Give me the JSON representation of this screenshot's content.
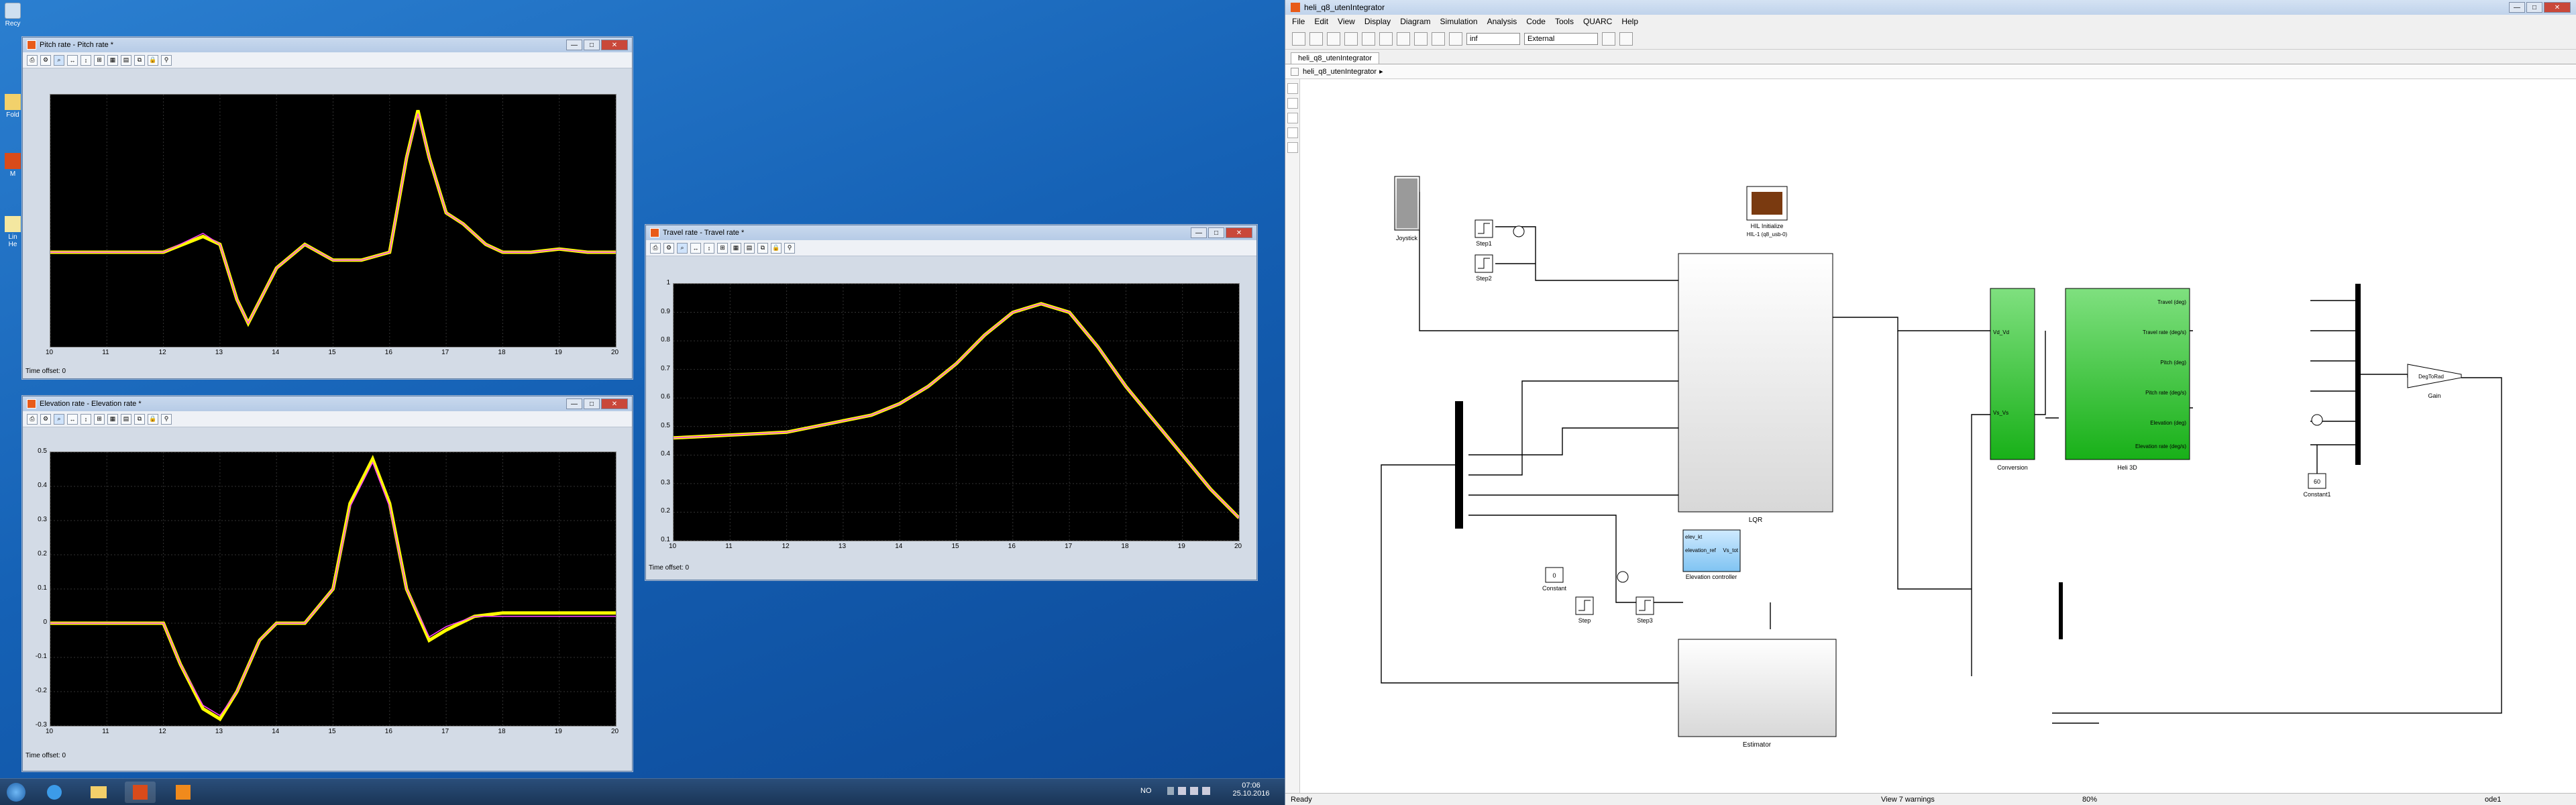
{
  "desktop": {
    "icons": [
      {
        "label": "Recy",
        "icon": "recycle-bin-icon"
      },
      {
        "label": "Fold",
        "icon": "folder-icon"
      },
      {
        "label": "M",
        "icon": "matlab-icon"
      },
      {
        "label": "Lin He",
        "icon": "document-icon"
      }
    ]
  },
  "scopes": [
    {
      "id": "pitch",
      "title": "Pitch rate - Pitch rate *",
      "time_offset_label": "Time offset:",
      "time_offset_value": "0",
      "chart_data": {
        "type": "line",
        "xlim": [
          10,
          20
        ],
        "ylim": [
          -0.6,
          1.0
        ],
        "x_ticks": [
          "10",
          "11",
          "12",
          "13",
          "14",
          "15",
          "16",
          "17",
          "18",
          "19",
          "20"
        ],
        "y_ticks": [],
        "background": "#000000",
        "series": [
          {
            "color": "#ffff00",
            "x": [
              10,
              11,
              12,
              12.7,
              13,
              13.3,
              13.5,
              14,
              14.5,
              15,
              15.5,
              16,
              16.3,
              16.5,
              16.7,
              17,
              17.3,
              17.7,
              18,
              18.5,
              19,
              19.5,
              20
            ],
            "y": [
              0,
              0,
              0,
              0.1,
              0.05,
              -0.3,
              -0.45,
              -0.1,
              0.05,
              -0.05,
              -0.05,
              0,
              0.6,
              0.9,
              0.6,
              0.25,
              0.18,
              0.05,
              0,
              0,
              0.02,
              0,
              0
            ]
          },
          {
            "color": "#ff40ff",
            "x": [
              10,
              11,
              12,
              12.7,
              13,
              13.3,
              13.5,
              14,
              14.5,
              15,
              15.5,
              16,
              16.3,
              16.5,
              16.7,
              17,
              17.3,
              17.7,
              18,
              18.5,
              19,
              19.5,
              20
            ],
            "y": [
              0,
              0,
              0,
              0.12,
              0.05,
              -0.3,
              -0.45,
              -0.1,
              0.05,
              -0.05,
              -0.05,
              0,
              0.6,
              0.88,
              0.6,
              0.25,
              0.18,
              0.05,
              0,
              0,
              0.02,
              0,
              0
            ]
          }
        ]
      }
    },
    {
      "id": "elevation",
      "title": "Elevation rate - Elevation rate *",
      "time_offset_label": "Time offset:",
      "time_offset_value": "0",
      "chart_data": {
        "type": "line",
        "xlim": [
          10,
          20
        ],
        "ylim": [
          -0.3,
          0.5
        ],
        "x_ticks": [
          "10",
          "11",
          "12",
          "13",
          "14",
          "15",
          "16",
          "17",
          "18",
          "19",
          "20"
        ],
        "y_ticks": [
          "0.5",
          "0.4",
          "0.3",
          "0.2",
          "0.1",
          "0",
          "-0.1",
          "-0.2",
          "-0.3"
        ],
        "background": "#000000",
        "series": [
          {
            "color": "#ffff00",
            "x": [
              10,
              11,
              12,
              12.3,
              12.7,
              13,
              13.3,
              13.7,
              14,
              14.5,
              15,
              15.3,
              15.7,
              16,
              16.3,
              16.7,
              17,
              17.5,
              18,
              18.5,
              19,
              19.5,
              20
            ],
            "y": [
              0,
              0,
              0,
              -0.12,
              -0.25,
              -0.28,
              -0.2,
              -0.05,
              0,
              0,
              0.1,
              0.35,
              0.48,
              0.35,
              0.1,
              -0.05,
              -0.02,
              0.02,
              0.03,
              0.03,
              0.03,
              0.03,
              0.03
            ]
          },
          {
            "color": "#ff40ff",
            "x": [
              10,
              11,
              12,
              12.3,
              12.7,
              13,
              13.3,
              13.7,
              14,
              14.5,
              15,
              15.3,
              15.7,
              16,
              16.3,
              16.7,
              17,
              17.5,
              18,
              18.5,
              19,
              19.5,
              20
            ],
            "y": [
              0,
              0,
              0,
              -0.12,
              -0.24,
              -0.27,
              -0.2,
              -0.05,
              0,
              0,
              0.1,
              0.34,
              0.47,
              0.34,
              0.1,
              -0.04,
              -0.01,
              0.02,
              0.02,
              0.02,
              0.02,
              0.02,
              0.02
            ]
          }
        ]
      }
    },
    {
      "id": "travel",
      "title": "Travel rate - Travel rate *",
      "time_offset_label": "Time offset:",
      "time_offset_value": "0",
      "chart_data": {
        "type": "line",
        "xlim": [
          10,
          20
        ],
        "ylim": [
          0.1,
          1.0
        ],
        "x_ticks": [
          "10",
          "11",
          "12",
          "13",
          "14",
          "15",
          "16",
          "17",
          "18",
          "19",
          "20"
        ],
        "y_ticks": [
          "1",
          "0.9",
          "0.8",
          "0.7",
          "0.6",
          "0.5",
          "0.4",
          "0.3",
          "0.2",
          "0.1"
        ],
        "background": "#000000",
        "series": [
          {
            "color": "#ffff00",
            "x": [
              10,
              11,
              12,
              12.5,
              13,
              13.5,
              14,
              14.5,
              15,
              15.5,
              16,
              16.5,
              17,
              17.5,
              18,
              18.5,
              19,
              19.5,
              20
            ],
            "y": [
              0.46,
              0.47,
              0.48,
              0.5,
              0.52,
              0.54,
              0.58,
              0.64,
              0.72,
              0.82,
              0.9,
              0.93,
              0.9,
              0.78,
              0.64,
              0.52,
              0.4,
              0.28,
              0.18
            ]
          },
          {
            "color": "#ff40ff",
            "x": [
              10,
              11,
              12,
              12.5,
              13,
              13.5,
              14,
              14.5,
              15,
              15.5,
              16,
              16.5,
              17,
              17.5,
              18,
              18.5,
              19,
              19.5,
              20
            ],
            "y": [
              0.46,
              0.47,
              0.48,
              0.5,
              0.52,
              0.54,
              0.58,
              0.64,
              0.72,
              0.82,
              0.9,
              0.93,
              0.9,
              0.78,
              0.64,
              0.52,
              0.4,
              0.28,
              0.18
            ]
          }
        ]
      }
    }
  ],
  "simulink": {
    "title": "heli_q8_utenIntegrator",
    "menu": [
      "File",
      "Edit",
      "View",
      "Display",
      "Diagram",
      "Simulation",
      "Analysis",
      "Code",
      "Tools",
      "QUARC",
      "Help"
    ],
    "stop_time": "inf",
    "mode": "External",
    "tab": "heli_q8_utenIntegrator",
    "address": "heli_q8_utenIntegrator",
    "status_left": "Ready",
    "status_mid": "View 7 warnings",
    "status_zoom": "80%",
    "status_right": "ode1",
    "blocks": {
      "joystick": "Joystick",
      "step1": "Step1",
      "step2": "Step2",
      "hil": "HIL Initialize",
      "hil_sub": "HIL-1 (q8_usb-0)",
      "lqr": "LQR",
      "conversion": "Conversion",
      "heli3d": "Heli 3D",
      "gain": "Gain",
      "gain_val": "DegToRad",
      "constant1": "Constant1",
      "constant1_val": "60",
      "elevation_controller": "Elevation controller",
      "constant": "Constant",
      "constant_val": "0",
      "step": "Step",
      "step3": "Step3",
      "estimator": "Estimator",
      "heli_outputs": [
        "Travel (deg)",
        "Travel rate (deg/s)",
        "Pitch (deg)",
        "Pitch rate (deg/s)",
        "Elevation (deg)",
        "Elevation rate (deg/s)"
      ],
      "conv_ports": [
        "Vd_Vd",
        "Vs_Vs"
      ],
      "elev_ports": [
        "elev_kt",
        "elevation_ref"
      ],
      "elev_out": "Vs_tot"
    }
  },
  "taskbar": {
    "lang": "NO",
    "time": "07:06",
    "date": "25.10.2016"
  }
}
